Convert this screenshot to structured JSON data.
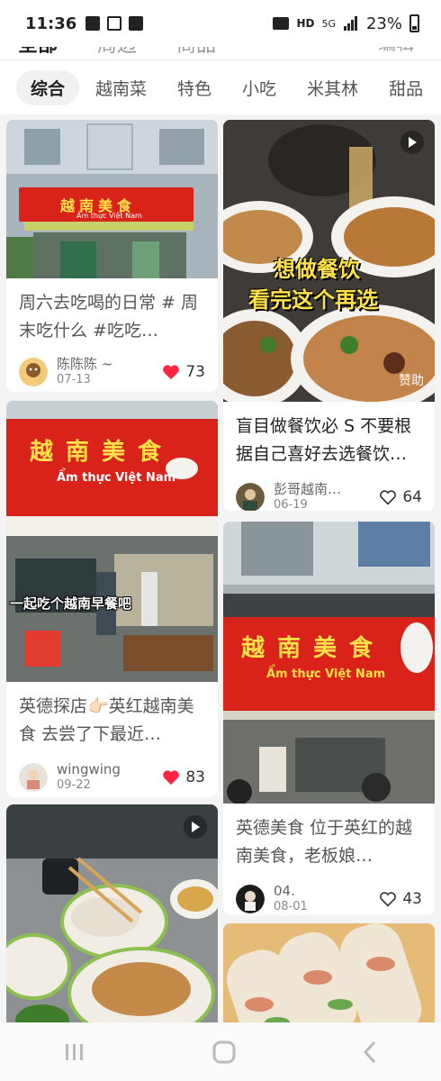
{
  "status_bar": {
    "time": "11:36",
    "network": "HD",
    "signal": "5G",
    "battery": "23%"
  },
  "top_tabs": {
    "items": [
      "全部",
      "周边",
      "商品"
    ],
    "edit_label": "编辑"
  },
  "categories": [
    "综合",
    "越南菜",
    "特色",
    "小吃",
    "米其林",
    "甜品"
  ],
  "posts": [
    {
      "title": "周六去吃喝的日常 # 周末吃什么 #吃吃…",
      "author": "陈陈陈 ~",
      "date": "07-13",
      "likes": "73",
      "liked": true,
      "video": false,
      "sign_cn": "越南美食",
      "sign_vn": "Ẩm thực Việt Nam"
    },
    {
      "title": "盲目做餐饮必 S 不要根据自己喜好去选餐饮…",
      "author": "彭哥越南…",
      "date": "06-19",
      "likes": "64",
      "liked": false,
      "video": true,
      "overlay_line1": "想做餐饮",
      "overlay_line2": "看完这个再选",
      "ad": "赞助"
    },
    {
      "title": "英德探店👉🏻英红越南美食 去尝了下最近…",
      "author": "wingwing",
      "date": "09-22",
      "likes": "83",
      "liked": true,
      "video": false,
      "sign_cn": "越南美食",
      "sign_vn": "Ẩm thực Việt Nam",
      "overlay": "一起吃个越南早餐吧"
    },
    {
      "title": "英德美食 位于英红的越南美食，老板娘…",
      "author": "04.",
      "date": "08-01",
      "likes": "43",
      "liked": false,
      "video": false,
      "sign_cn": "越南美食",
      "sign_vn": "Ẩm thực Việt Nam"
    },
    {
      "video": true
    },
    {
      "video": false
    }
  ],
  "colors": {
    "accent_red": "#ff2442",
    "sign_red": "#d8221a",
    "sign_yellow": "#ffe14a"
  }
}
